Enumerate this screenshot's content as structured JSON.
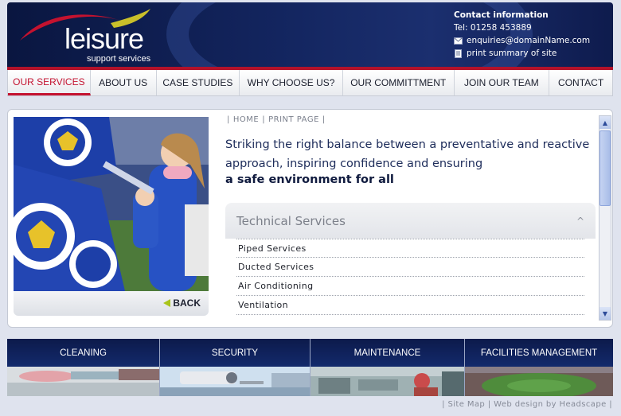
{
  "brand": {
    "name": "leisure",
    "tagline": "support services",
    "colors": {
      "navy": "#13255f",
      "red": "#c4122f",
      "lime": "#c9c02a"
    }
  },
  "contact": {
    "title": "Contact information",
    "tel": "Tel: 01258 453889",
    "email": "enquiries@domainName.com",
    "print_summary": "print summary of site"
  },
  "nav": [
    {
      "label": "OUR SERVICES",
      "active": true
    },
    {
      "label": "ABOUT US"
    },
    {
      "label": "CASE STUDIES"
    },
    {
      "label": "WHY CHOOSE US?"
    },
    {
      "label": "OUR COMMITTMENT"
    },
    {
      "label": "JOIN OUR TEAM"
    },
    {
      "label": "CONTACT"
    }
  ],
  "breadcrumb": {
    "home": "HOME",
    "print": "PRINT PAGE"
  },
  "intro": {
    "text": "Striking the right balance between a preventative and reactive approach, inspiring confidence and ensuring",
    "bold": "a safe environment for all"
  },
  "back_label": "BACK",
  "accordion": {
    "title": "Technical Services",
    "caret": "^",
    "items": [
      "Piped Services",
      "Ducted Services",
      "Air Conditioning",
      "Ventilation"
    ]
  },
  "tiles": [
    {
      "label": "CLEANING"
    },
    {
      "label": "SECURITY"
    },
    {
      "label": "MAINTENANCE"
    },
    {
      "label": "FACILITIES MANAGEMENT"
    }
  ],
  "footer": {
    "sitemap": "Site Map",
    "credit": "Web design by Headscape"
  }
}
